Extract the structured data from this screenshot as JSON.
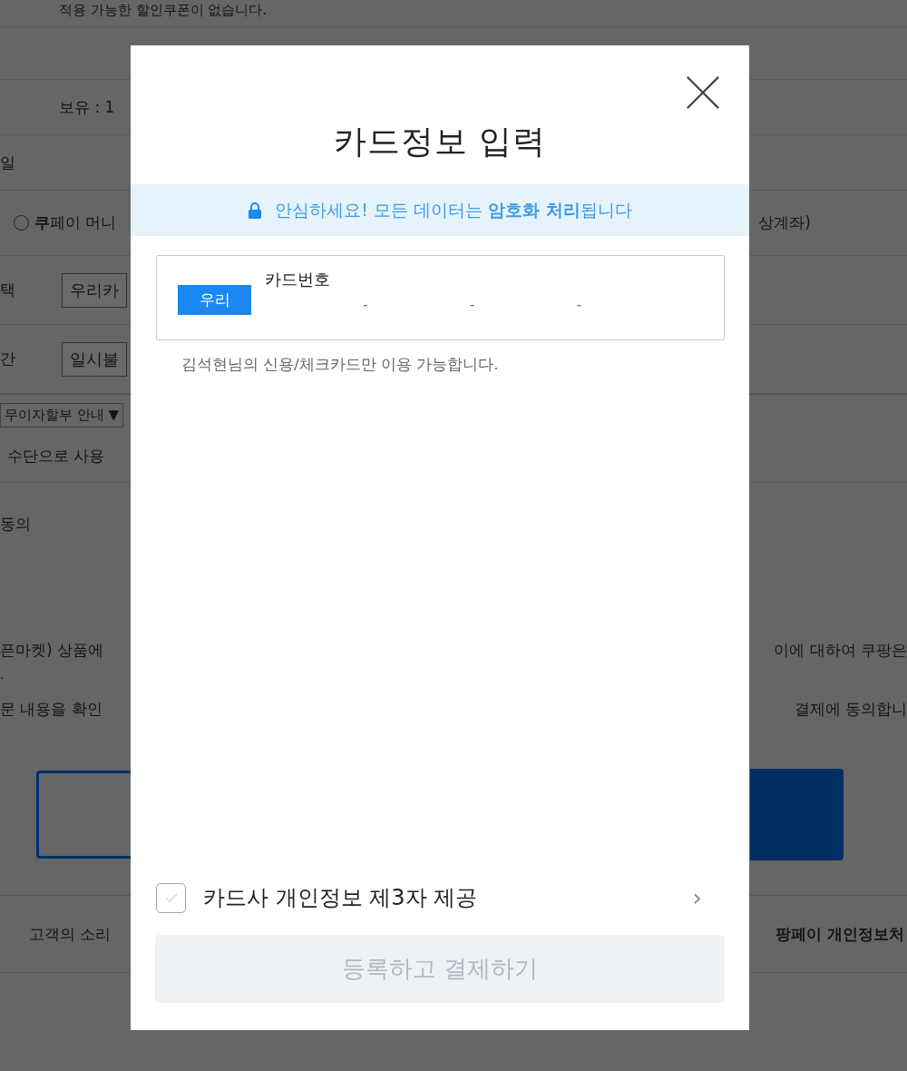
{
  "background": {
    "notice": "적용 가능한 할인쿠폰이 없습니다.",
    "balance": "보유 : 1",
    "section_label": "일",
    "payment_option": {
      "label": "**쿠**페이 머니",
      "selected": false,
      "right": "상계좌)"
    },
    "card_row": {
      "label": "택",
      "value": "우리카"
    },
    "installment_row": {
      "label": "간",
      "value": "일시불"
    },
    "interest_free": {
      "label": "무이자할부 안내",
      "caret": "▼"
    },
    "use_as": "수단으로 사용",
    "consent": "동의",
    "notice_left": "픈마켓) 상품에",
    "notice_right": "이에 대하여 쿠팡은",
    "notice_dot": ".",
    "agree_left": "문 내용을 확인",
    "agree_right": "결제에 동의합니",
    "footer_left": "고객의 소리",
    "footer_right": "팡페이 개인정보처"
  },
  "modal": {
    "title": "카드정보 입력",
    "security_banner": "안심하세요! 모든 데이터는 **암호화 처리**됩니다",
    "card": {
      "issuer": "우리",
      "label": "카드번호",
      "separators": [
        "-",
        "-",
        "-"
      ]
    },
    "hint": "김석현님의 신용/체크카드만 이용 가능합니다.",
    "consent": {
      "label": "카드사 개인정보 제3자 제공",
      "checked": false,
      "chevron": "›"
    },
    "submit": {
      "label": "등록하고 결제하기",
      "disabled": true
    }
  }
}
